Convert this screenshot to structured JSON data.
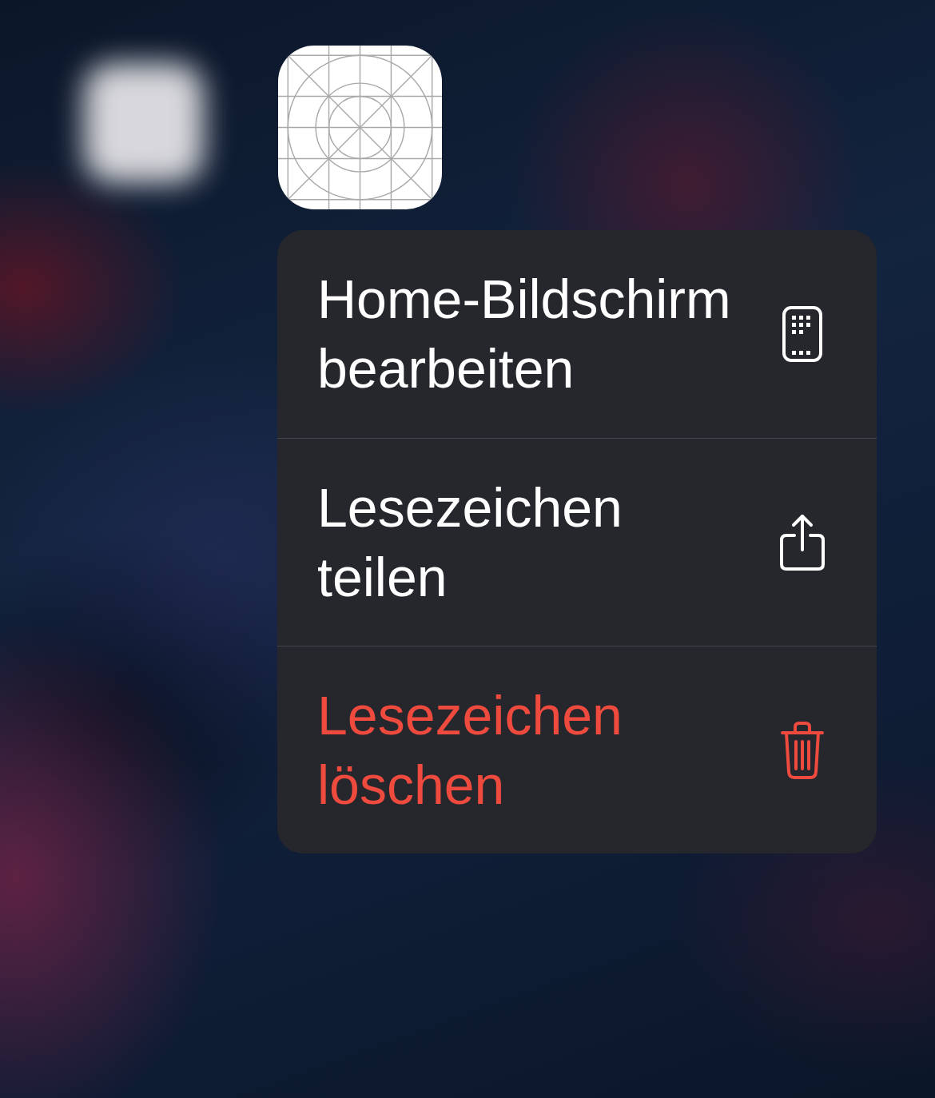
{
  "context_menu": {
    "items": [
      {
        "label": "Home-Bildschirm bearbeiten",
        "kind": "edit",
        "destructive": false
      },
      {
        "label": "Lesezeichen teilen",
        "kind": "share",
        "destructive": false
      },
      {
        "label": "Lesezeichen löschen",
        "kind": "delete",
        "destructive": true
      }
    ]
  }
}
